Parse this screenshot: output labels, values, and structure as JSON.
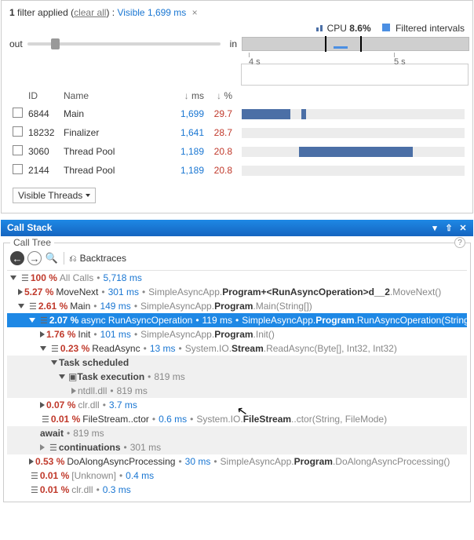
{
  "filter": {
    "applied_text": "filter applied",
    "clear_text": "clear all",
    "label": "Visible",
    "value_ms": "1,699 ms"
  },
  "cpu": {
    "label": "CPU",
    "value": "8.6%"
  },
  "legend": {
    "filtered_intervals": "Filtered intervals"
  },
  "zoom": {
    "label_out": "out",
    "label_in": "in"
  },
  "ruler": {
    "ticks": [
      "4 s",
      "5 s"
    ]
  },
  "threads_header": {
    "id": "ID",
    "name": "Name",
    "ms": "ms",
    "pct": "%"
  },
  "threads": [
    {
      "id": "6844",
      "name": "Main",
      "ms": "1,699",
      "pct": "29.7",
      "bars": [
        {
          "l": 0,
          "w": 62
        },
        {
          "l": 76,
          "w": 6
        }
      ]
    },
    {
      "id": "18232",
      "name": "Finalizer",
      "ms": "1,641",
      "pct": "28.7",
      "bars": []
    },
    {
      "id": "3060",
      "name": "Thread Pool",
      "ms": "1,189",
      "pct": "20.8",
      "bars": [
        {
          "l": 73,
          "w": 145
        }
      ]
    },
    {
      "id": "2144",
      "name": "Thread Pool",
      "ms": "1,189",
      "pct": "20.8",
      "bars": []
    }
  ],
  "visible_threads_btn": "Visible Threads",
  "callstack_title": "Call Stack",
  "calltree_title": "Call Tree",
  "toolbar": {
    "backtraces": "Backtraces"
  },
  "tree": {
    "allcalls": {
      "pct": "100 %",
      "label": "All Calls",
      "ms": "5,718 ms"
    },
    "movenext": {
      "pct": "5.27 %",
      "fn": "MoveNext",
      "ms": "301 ms",
      "p1": "SimpleAsyncApp.",
      "p2": "Program+<RunAsyncOperation>d__2",
      "p3": ".MoveNext()"
    },
    "main": {
      "pct": "2.61 %",
      "fn": "Main",
      "ms": "149 ms",
      "p1": "SimpleAsyncApp.",
      "p2": "Program",
      "p3": ".Main(String[])"
    },
    "runasync": {
      "pct": "2.07 %",
      "fn": "async RunAsyncOperation",
      "ms": "119 ms",
      "p1": "SimpleAsyncApp.",
      "p2": "Program",
      "p3": ".RunAsyncOperation(String)"
    },
    "init": {
      "pct": "1.76 %",
      "fn": "Init",
      "ms": "101 ms",
      "p1": "SimpleAsyncApp.",
      "p2": "Program",
      "p3": ".Init()"
    },
    "readasync": {
      "pct": "0.23 %",
      "fn": "ReadAsync",
      "ms": "13 ms",
      "p1": "System.IO.",
      "p2": "Stream",
      "p3": ".ReadAsync(Byte[], Int32, Int32)"
    },
    "tasksched": {
      "label": "Task scheduled"
    },
    "taskexec": {
      "label": "Task execution",
      "ms": "819 ms"
    },
    "ntdll": {
      "label": "ntdll.dll",
      "ms": "819 ms"
    },
    "clr37": {
      "pct": "0.07 %",
      "fn": "clr.dll",
      "ms": "3.7 ms"
    },
    "filestream": {
      "pct": "0.01 %",
      "fn": "FileStream..ctor",
      "ms": "0.6 ms",
      "p1": "System.IO.",
      "p2": "FileStream",
      "p3": "..ctor(String, FileMode)"
    },
    "await": {
      "label": "await",
      "ms": "819 ms"
    },
    "continuations": {
      "label": "continuations",
      "ms": "301 ms"
    },
    "doalong": {
      "pct": "0.53 %",
      "fn": "DoAlongAsyncProcessing",
      "ms": "30 ms",
      "p1": "SimpleAsyncApp.",
      "p2": "Program",
      "p3": ".DoAlongAsyncProcessing()"
    },
    "unknown": {
      "pct": "0.01 %",
      "fn": "[Unknown]",
      "ms": "0.4 ms"
    },
    "clr03": {
      "pct": "0.01 %",
      "fn": "clr.dll",
      "ms": "0.3 ms"
    }
  }
}
